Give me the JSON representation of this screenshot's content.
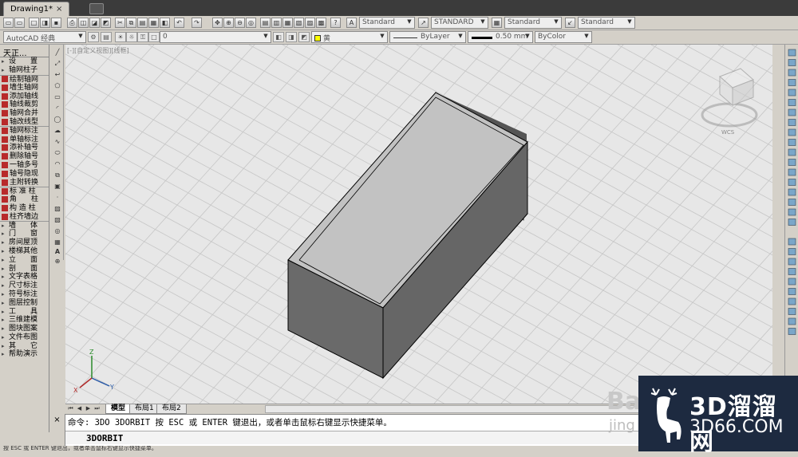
{
  "window": {
    "tab_title": "Drawing1*",
    "tab_close": "×"
  },
  "toolbar_top": {
    "styles": {
      "text_style": "Standard",
      "dim_style": "STANDARD",
      "table_style": "Standard",
      "multileader_style": "Standard"
    }
  },
  "toolbar_props": {
    "workspace": "AutoCAD 经典",
    "layer": "0",
    "color": "黄",
    "linetype": "ByLayer",
    "lineweight": "0.50 mm",
    "plotstyle": "ByColor"
  },
  "viewport": {
    "label": "[-][自定义视图][线框]",
    "wcs": "WCS"
  },
  "sidebar": {
    "header": "天正...",
    "items": [
      {
        "label": "设　　置",
        "type": "menu"
      },
      {
        "label": "轴网柱子",
        "type": "menu"
      },
      {
        "label": "绘制轴网",
        "type": "cmd"
      },
      {
        "label": "墙生轴网",
        "type": "cmd"
      },
      {
        "label": "添加轴线",
        "type": "cmd"
      },
      {
        "label": "轴线裁剪",
        "type": "cmd"
      },
      {
        "label": "轴网合并",
        "type": "cmd"
      },
      {
        "label": "轴改线型",
        "type": "cmd"
      },
      {
        "label": "轴网标注",
        "type": "cmd"
      },
      {
        "label": "单轴标注",
        "type": "cmd"
      },
      {
        "label": "添补轴号",
        "type": "cmd"
      },
      {
        "label": "删除轴号",
        "type": "cmd"
      },
      {
        "label": "一轴多号",
        "type": "cmd"
      },
      {
        "label": "轴号隐现",
        "type": "cmd"
      },
      {
        "label": "主附转换",
        "type": "cmd"
      },
      {
        "label": "标 准 柱",
        "type": "cmd"
      },
      {
        "label": "角　　柱",
        "type": "cmd"
      },
      {
        "label": "构 造 柱",
        "type": "cmd"
      },
      {
        "label": "柱齐墙边",
        "type": "cmd"
      },
      {
        "label": "墙　　体",
        "type": "menu"
      },
      {
        "label": "门　　窗",
        "type": "menu"
      },
      {
        "label": "房间屋顶",
        "type": "menu"
      },
      {
        "label": "楼梯其他",
        "type": "menu"
      },
      {
        "label": "立　　面",
        "type": "menu"
      },
      {
        "label": "剖　　面",
        "type": "menu"
      },
      {
        "label": "文字表格",
        "type": "menu"
      },
      {
        "label": "尺寸标注",
        "type": "menu"
      },
      {
        "label": "符号标注",
        "type": "menu"
      },
      {
        "label": "图层控制",
        "type": "menu"
      },
      {
        "label": "工　　具",
        "type": "menu"
      },
      {
        "label": "三维建模",
        "type": "menu"
      },
      {
        "label": "图块图案",
        "type": "menu"
      },
      {
        "label": "文件布图",
        "type": "menu"
      },
      {
        "label": "其　　它",
        "type": "menu"
      },
      {
        "label": "帮助演示",
        "type": "menu"
      }
    ]
  },
  "layout_tabs": [
    "模型",
    "布局1",
    "布局2"
  ],
  "command": {
    "history": "命令: 3DO 3DORBIT 按 ESC 或 ENTER 键退出，或者单击鼠标右键显示快捷菜单。",
    "input": "3DORBIT",
    "status": "按 ESC 或 ENTER 键退出，或者单击鼠标右键显示快捷菜单。"
  },
  "watermark": {
    "title": "3D溜溜网",
    "url": "3D66.COM",
    "ghost": "Bai",
    "ghost_url": "jing"
  },
  "colors": {
    "box_side": "#666666",
    "box_top": "#c0c0c0",
    "inner_wall": "#555555",
    "grid": "#c4c4c4",
    "watermark_bg": "#1d2a40"
  }
}
